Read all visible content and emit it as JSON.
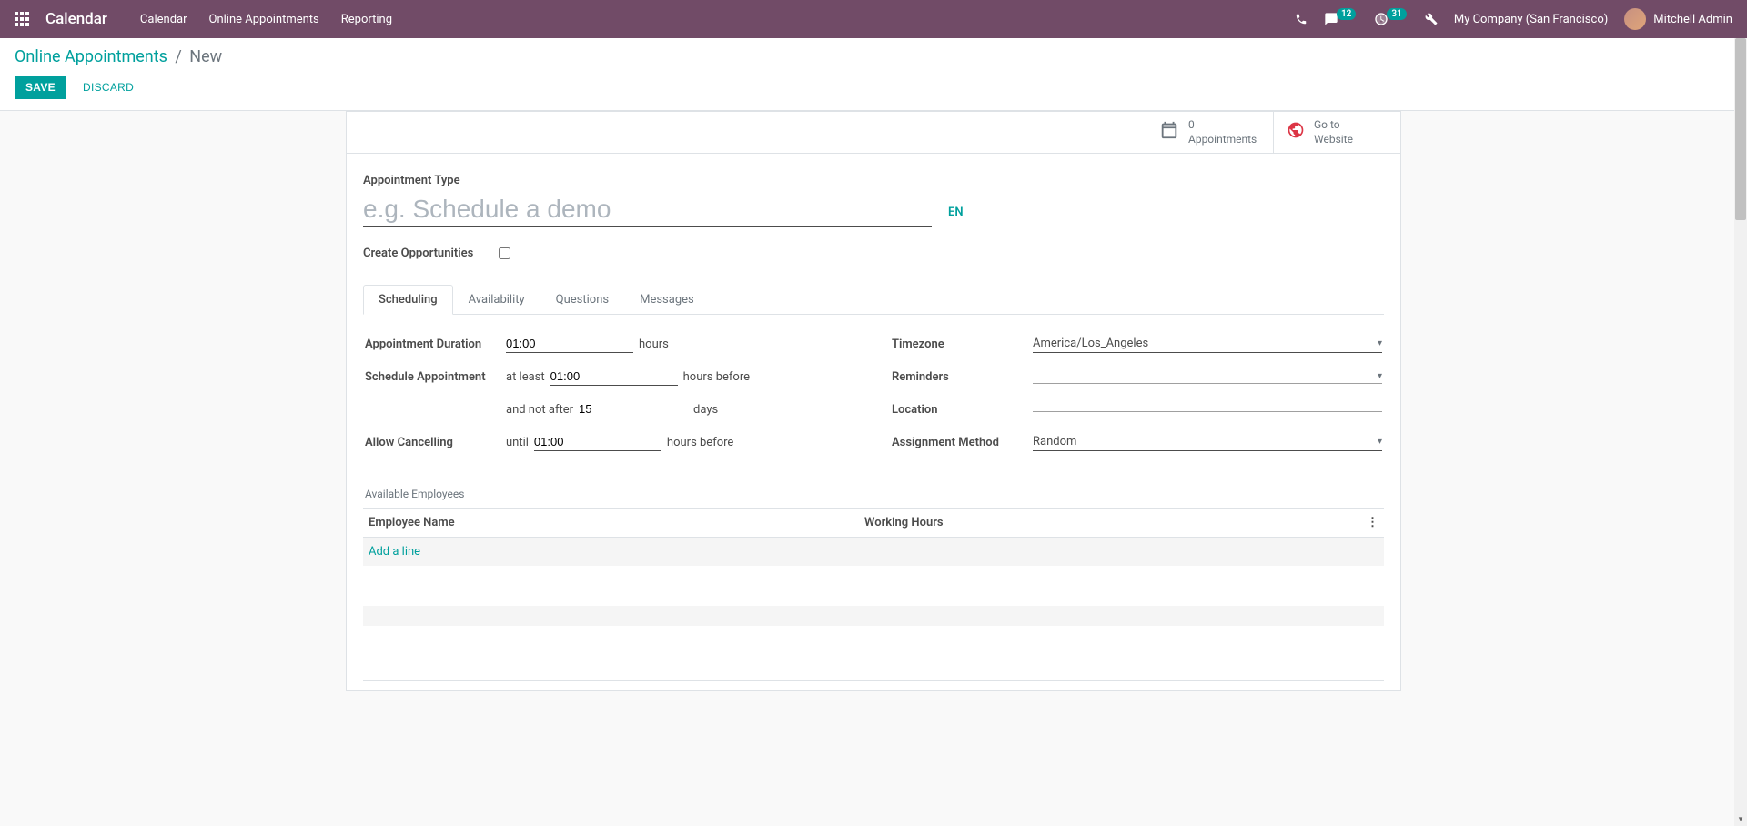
{
  "navbar": {
    "brand": "Calendar",
    "links": [
      "Calendar",
      "Online Appointments",
      "Reporting"
    ],
    "messages_count": "12",
    "activities_count": "31",
    "company": "My Company (San Francisco)",
    "user": "Mitchell Admin"
  },
  "breadcrumb": {
    "parent": "Online Appointments",
    "current": "New"
  },
  "buttons": {
    "save": "SAVE",
    "discard": "DISCARD"
  },
  "stat": {
    "appt_count": "0",
    "appt_label": "Appointments",
    "goto_line1": "Go to",
    "goto_line2": "Website"
  },
  "form": {
    "appt_type_label": "Appointment Type",
    "appt_type_placeholder": "e.g. Schedule a demo",
    "appt_type_value": "",
    "lang": "EN",
    "create_opp_label": "Create Opportunities"
  },
  "tabs": [
    "Scheduling",
    "Availability",
    "Questions",
    "Messages"
  ],
  "scheduling": {
    "duration_label": "Appointment Duration",
    "duration_value": "01:00",
    "duration_unit": "hours",
    "schedule_label": "Schedule Appointment",
    "schedule_prefix": "at least",
    "schedule_min_value": "01:00",
    "schedule_min_unit": "hours before",
    "schedule_max_prefix": "and not after",
    "schedule_max_value": "15",
    "schedule_max_unit": "days",
    "cancel_label": "Allow Cancelling",
    "cancel_prefix": "until",
    "cancel_value": "01:00",
    "cancel_unit": "hours before",
    "timezone_label": "Timezone",
    "timezone_value": "America/Los_Angeles",
    "reminders_label": "Reminders",
    "reminders_value": "",
    "location_label": "Location",
    "location_value": "",
    "assign_label": "Assignment Method",
    "assign_value": "Random"
  },
  "employees": {
    "section": "Available Employees",
    "col_name": "Employee Name",
    "col_hours": "Working Hours",
    "add_line": "Add a line"
  }
}
